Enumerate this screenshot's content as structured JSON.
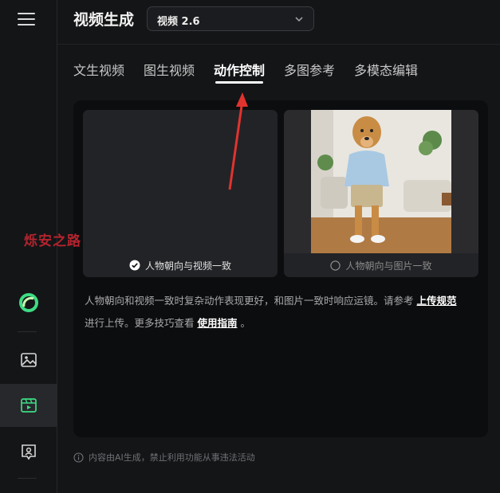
{
  "sidebar": {
    "menu_icon": "hamburger-menu-icon",
    "items": [
      {
        "icon": "brand-logo-icon",
        "active": false
      },
      {
        "icon": "image-icon",
        "active": false
      },
      {
        "icon": "video-icon",
        "active": true
      },
      {
        "icon": "avatar-mic-icon",
        "active": false
      }
    ],
    "accent": "#3ddc84"
  },
  "header": {
    "title": "视频生成",
    "model_select": {
      "value": "视频 2.6",
      "icon": "chevron-down-icon"
    }
  },
  "tabs": [
    {
      "label": "文生视频",
      "active": false
    },
    {
      "label": "图生视频",
      "active": false
    },
    {
      "label": "动作控制",
      "active": true
    },
    {
      "label": "多图参考",
      "active": false
    },
    {
      "label": "多模态编辑",
      "active": false
    }
  ],
  "options": {
    "video_card": {
      "label": "人物朝向与视频一致",
      "selected": true
    },
    "image_card": {
      "label": "人物朝向与图片一致",
      "selected": false
    }
  },
  "description": {
    "text_1": "人物朝向和视频一致时复杂动作表现更好，和图片一致时响应运镜。请参考",
    "link_1": "上传规范",
    "text_2": "进行上传。更多技巧查看",
    "link_2": "使用指南",
    "text_3": "。"
  },
  "footer": {
    "note": "内容由AI生成，禁止利用功能从事违法活动",
    "icon": "info-icon"
  },
  "watermark": "烁安之路",
  "colors": {
    "arrow": "#e0332f",
    "watermark": "#b3242e"
  }
}
